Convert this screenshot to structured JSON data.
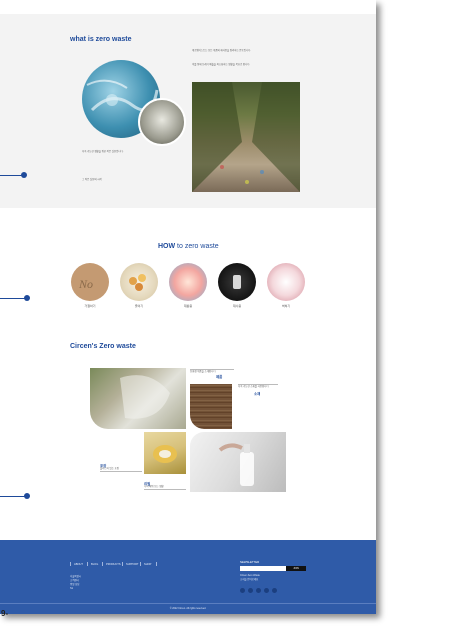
{
  "section1": {
    "title": "what is zero waste",
    "intro_paragraph": "제로웨이스트는 모든 제품의 재사용을 장려하는 운동입니다.",
    "sub_paragraph": "이를 통해 쓰레기 배출을 최소화하는 생활을 목표로 합니다.",
    "left_paragraph": "지속 가능한 생활을 위한 작은 실천입니다.",
    "left_caption": "그 작은 실천의 시작"
  },
  "section2": {
    "title_bold": "HOW",
    "title_rest": " to zero waste",
    "items": [
      {
        "label": "거절하기"
      },
      {
        "label": "줄이기"
      },
      {
        "label": "재활용"
      },
      {
        "label": "재사용"
      },
      {
        "label": "썩히기"
      }
    ]
  },
  "section3": {
    "title": "Circen's Zero waste",
    "cards": [
      {
        "desc": "친환경 제품을 소개합니다",
        "title": "제품"
      },
      {
        "desc": "지속 가능한 소재를 사용합니다",
        "title": "소재"
      },
      {
        "title": "포장",
        "desc": "플라스틱 없는 포장"
      },
      {
        "title": "리필",
        "desc": "다시 채워 쓰는 생활"
      }
    ]
  },
  "footer": {
    "nav": [
      "ABOUT",
      "BLOG",
      "PRODUCTS",
      "SUPPORT",
      "SHOP"
    ],
    "info_lines": [
      "서울특별시",
      "고객센터",
      "평일 상담",
      "Tel"
    ],
    "newsletter_title": "NEWSLETTER",
    "newsletter_button": "JOIN",
    "newsletter_note_1": "Circen Zero Waste",
    "newsletter_note_2": "소식을 받아보세요",
    "copyright": "© 2022 Circen. All rights reserved.",
    "sns_icons": [
      "instagram-icon",
      "facebook-icon",
      "twitter-icon",
      "youtube-icon",
      "blog-icon"
    ]
  },
  "outside_label": "9-",
  "colors": {
    "accent": "#1e4a9a",
    "footer_bg": "#2f5ba8",
    "section_gray": "#f3f3f3"
  }
}
